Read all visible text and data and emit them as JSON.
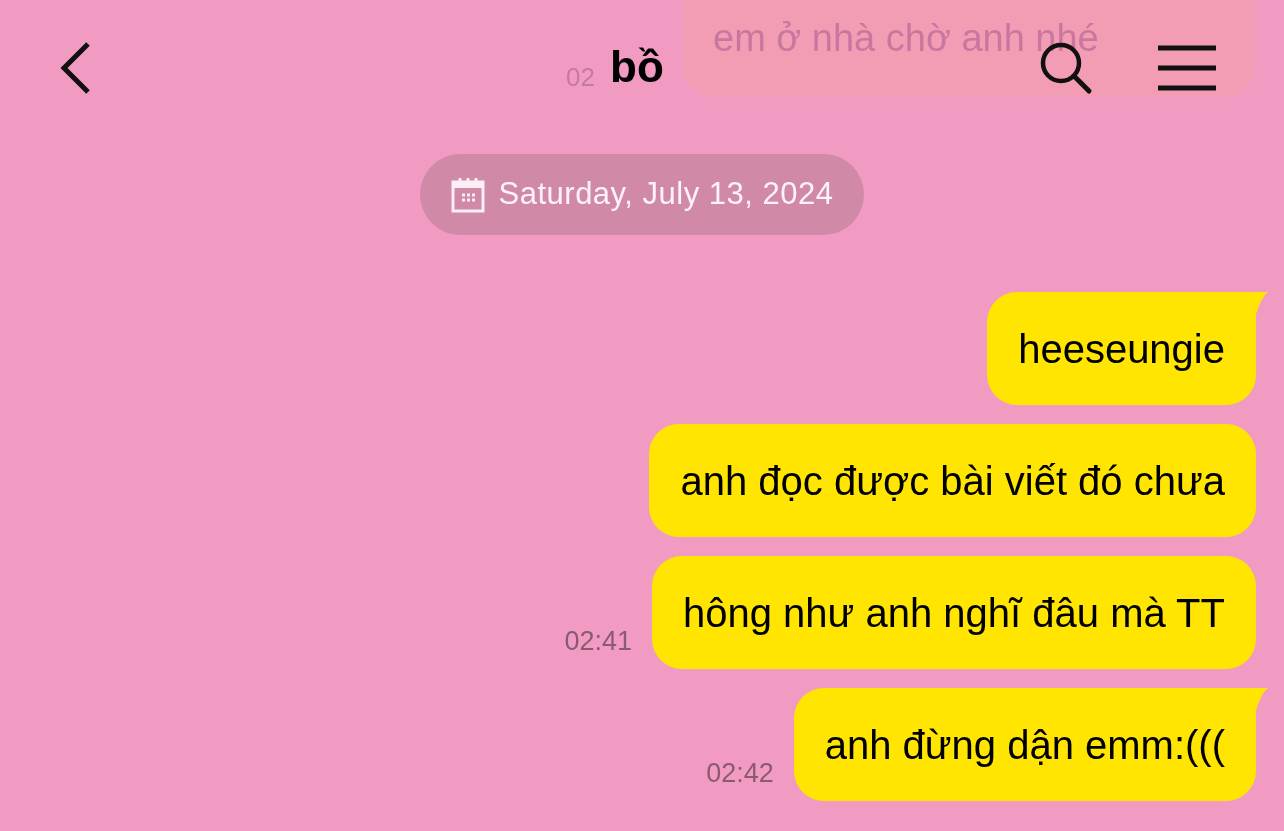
{
  "header": {
    "title": "bồ"
  },
  "faded_message": {
    "text": "em ở nhà chờ anh nhé",
    "time": "02"
  },
  "date_chip": {
    "text": "Saturday, July 13, 2024"
  },
  "messages": [
    {
      "text": "heeseungie",
      "tail": true
    },
    {
      "text": "anh đọc được bài viết đó chưa",
      "tail": false
    },
    {
      "text": "hông như anh nghĩ đâu mà TT",
      "tail": false,
      "time": "02:41"
    },
    {
      "text": "anh đừng dận emm:(((",
      "tail": true,
      "time": "02:42"
    }
  ]
}
